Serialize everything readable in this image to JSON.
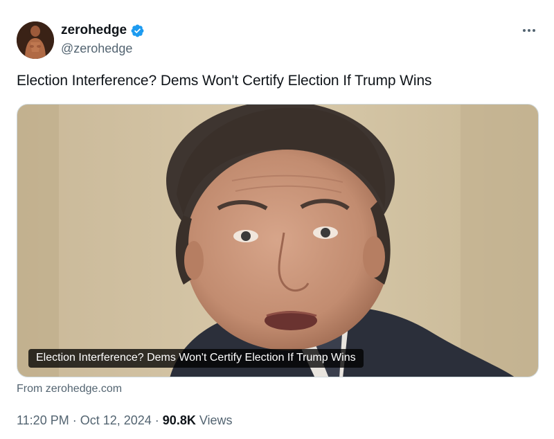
{
  "author": {
    "display_name": "zerohedge",
    "handle": "@zerohedge",
    "verified_icon": "verified-badge-icon",
    "verified_color": "#1d9bf0"
  },
  "tweet": {
    "text": "Election Interference? Dems Won't Certify Election If Trump Wins",
    "card_caption": "Election Interference? Dems Won't Certify Election If Trump Wins",
    "card_source": "From zerohedge.com",
    "time": "11:20 PM",
    "separator": "·",
    "date": "Oct 12, 2024",
    "views_count": "90.8K",
    "views_label": "Views"
  },
  "icons": {
    "more": "more-options-icon"
  },
  "colors": {
    "text_primary": "#0f1419",
    "text_secondary": "#536471",
    "border": "#cfd9de"
  }
}
